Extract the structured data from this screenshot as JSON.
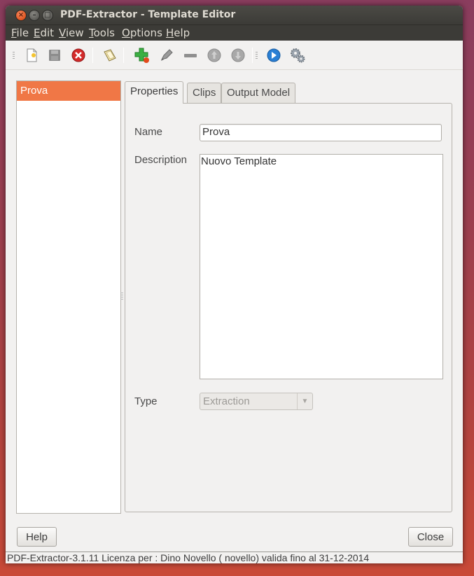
{
  "window": {
    "title": "PDF-Extractor - Template Editor",
    "controls": {
      "close": "×",
      "minimize": "–",
      "maximize": "□"
    }
  },
  "menubar": {
    "items": [
      {
        "mnemonic": "F",
        "rest": "ile"
      },
      {
        "mnemonic": "E",
        "rest": "dit"
      },
      {
        "mnemonic": "V",
        "rest": "iew"
      },
      {
        "mnemonic": "T",
        "rest": "ools"
      },
      {
        "mnemonic": "O",
        "rest": "ptions"
      },
      {
        "mnemonic": "H",
        "rest": "elp"
      }
    ]
  },
  "toolbar": {
    "icons": [
      "new-template-icon",
      "save-icon",
      "delete-icon",
      "open-icon",
      "add-clip-icon",
      "edit-clip-icon",
      "remove-icon",
      "move-up-icon",
      "move-down-icon",
      "run-icon",
      "settings-icon"
    ]
  },
  "template_list": {
    "items": [
      {
        "label": "Prova",
        "selected": true
      }
    ]
  },
  "tabs": [
    {
      "label": "Properties",
      "active": true
    },
    {
      "label": "Clips",
      "active": false
    },
    {
      "label": "Output Model",
      "active": false
    }
  ],
  "properties": {
    "name_label": "Name",
    "name_value": "Prova",
    "description_label": "Description",
    "description_value": "Nuovo Template",
    "type_label": "Type",
    "type_value": "Extraction"
  },
  "buttons": {
    "help": "Help",
    "close": "Close"
  },
  "status": {
    "text": "PDF-Extractor-3.1.11  Licenza per : Dino Novello ( novello) valida fino al 31-12-2014"
  },
  "colors": {
    "selection": "#f07746",
    "titlebar": "#3c3b37",
    "window_bg": "#f2f1f0"
  }
}
